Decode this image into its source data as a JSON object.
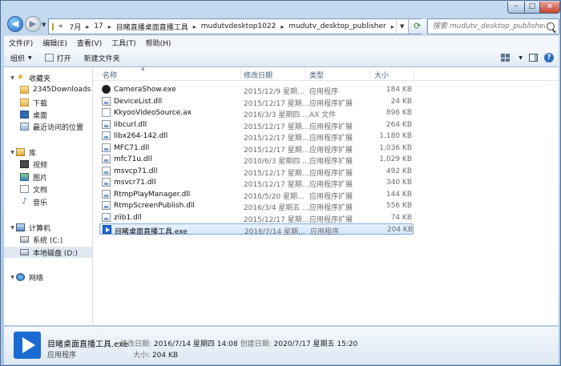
{
  "breadcrumbs": [
    "«",
    "7月",
    "17",
    "目睹直播桌面直播工具",
    "mudutvdesktop1022",
    "mudutv_desktop_publisher"
  ],
  "search": {
    "placeholder": "搜索 mudutv_desktop_publisher"
  },
  "menu": [
    "文件(F)",
    "编辑(E)",
    "查看(V)",
    "工具(T)",
    "帮助(H)"
  ],
  "toolbar": {
    "organize": "组织",
    "open": "打开",
    "new_folder": "新建文件夹"
  },
  "nav": {
    "favorites": "收藏夹",
    "fav_items": [
      "2345Downloads",
      "下载",
      "桌面",
      "最近访问的位置"
    ],
    "library": "库",
    "lib_items": [
      "视频",
      "图片",
      "文档",
      "音乐"
    ],
    "computer": "计算机",
    "drives": [
      "系统 (C:)",
      "本地磁盘 (D:)"
    ],
    "network": "网络"
  },
  "columns": {
    "name": "名称",
    "date": "修改日期",
    "type": "类型",
    "size": "大小"
  },
  "files": [
    {
      "name": "CameraShow.exe",
      "date": "2015/12/9 星期...",
      "type": "应用程序",
      "size": "184 KB",
      "icon": "exe-icon"
    },
    {
      "name": "DeviceList.dll",
      "date": "2015/12/17 星期...",
      "type": "应用程序扩展",
      "size": "24 KB",
      "icon": "dll-icon"
    },
    {
      "name": "KkyooVideoSource.ax",
      "date": "2016/3/3 星期四 ...",
      "type": "AX 文件",
      "size": "896 KB",
      "icon": "ax-file-icon"
    },
    {
      "name": "libcurl.dll",
      "date": "2015/12/17 星期...",
      "type": "应用程序扩展",
      "size": "264 KB",
      "icon": "dll-icon"
    },
    {
      "name": "libx264-142.dll",
      "date": "2015/12/17 星期...",
      "type": "应用程序扩展",
      "size": "1,180 KB",
      "icon": "dll-icon"
    },
    {
      "name": "MFC71.dll",
      "date": "2015/12/17 星期...",
      "type": "应用程序扩展",
      "size": "1,036 KB",
      "icon": "dll-icon"
    },
    {
      "name": "mfc71u.dll",
      "date": "2010/6/3 星期四 ...",
      "type": "应用程序扩展",
      "size": "1,029 KB",
      "icon": "dll-icon"
    },
    {
      "name": "msvcp71.dll",
      "date": "2015/12/17 星期...",
      "type": "应用程序扩展",
      "size": "492 KB",
      "icon": "dll-icon"
    },
    {
      "name": "msvcr71.dll",
      "date": "2015/12/17 星期...",
      "type": "应用程序扩展",
      "size": "340 KB",
      "icon": "dll-icon"
    },
    {
      "name": "RtmpPlayManager.dll",
      "date": "2016/5/20 星期...",
      "type": "应用程序扩展",
      "size": "144 KB",
      "icon": "dll-icon"
    },
    {
      "name": "RtmpScreenPublish.dll",
      "date": "2016/3/4 星期五 ...",
      "type": "应用程序扩展",
      "size": "556 KB",
      "icon": "dll-icon"
    },
    {
      "name": "zlib1.dll",
      "date": "2015/12/17 星期...",
      "type": "应用程序扩展",
      "size": "74 KB",
      "icon": "dll-icon"
    },
    {
      "name": "目睹桌面直播工具.exe",
      "date": "2016/7/14 星期...",
      "type": "应用程序",
      "size": "204 KB",
      "icon": "mudu-exe-icon"
    }
  ],
  "details": {
    "name": "目睹桌面直播工具.exe",
    "modified_label": "修改日期:",
    "modified": "2016/7/14 星期四 14:08",
    "created_label": "创建日期:",
    "created": "2020/7/17 星期五 15:20",
    "type": "应用程序",
    "size_label": "大小:",
    "size": "204 KB"
  }
}
